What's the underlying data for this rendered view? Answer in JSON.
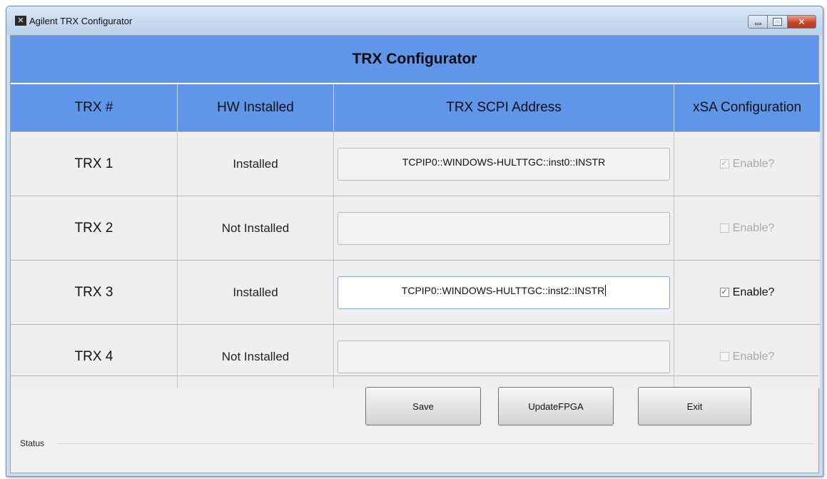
{
  "window": {
    "title": "Agilent TRX Configurator",
    "app_icon_glyph": "✕",
    "controls": {
      "minimize": "minimize-icon",
      "maximize": "maximize-icon",
      "close": "✕"
    }
  },
  "header": {
    "title": "TRX Configurator"
  },
  "table": {
    "columns": [
      "TRX #",
      "HW Installed",
      "TRX SCPI Address",
      "xSA Configuration"
    ],
    "rows": [
      {
        "trx": "TRX 1",
        "hw": "Installed",
        "address": "TCPIP0::WINDOWS-HULTTGC::inst0::INSTR",
        "enable_label": "Enable?",
        "checked_mark": "✓",
        "checked": true,
        "enabled": false
      },
      {
        "trx": "TRX 2",
        "hw": "Not Installed",
        "address": "",
        "enable_label": "Enable?",
        "checked_mark": "",
        "checked": false,
        "enabled": false
      },
      {
        "trx": "TRX 3",
        "hw": "Installed",
        "address": "TCPIP0::WINDOWS-HULTTGC::inst2::INSTR",
        "enable_label": "Enable?",
        "checked_mark": "✓",
        "checked": true,
        "enabled": true
      },
      {
        "trx": "TRX 4",
        "hw": "Not Installed",
        "address": "",
        "enable_label": "Enable?",
        "checked_mark": "",
        "checked": false,
        "enabled": false
      }
    ]
  },
  "buttons": {
    "save": "Save",
    "update": "UpdateFPGA",
    "exit": "Exit"
  },
  "status": {
    "label": "Status"
  },
  "colors": {
    "header_blue": "#5f96ea",
    "panel": "#f0f0f0"
  }
}
